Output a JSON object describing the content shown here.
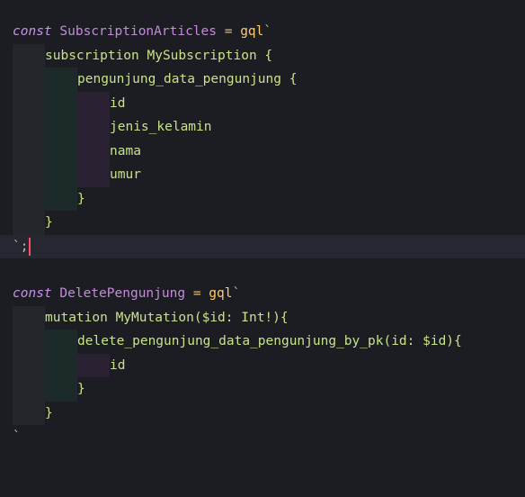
{
  "editor": {
    "block1": {
      "keyword": "const",
      "name": "SubscriptionArticles",
      "equals": "=",
      "tag": "gql",
      "open_tick": "`",
      "lines": [
        "subscription MySubscription {",
        "pengunjung_data_pengunjung {",
        "id",
        "jenis_kelamin",
        "nama",
        "umur",
        "}",
        "}"
      ],
      "close": "`;"
    },
    "block2": {
      "keyword": "const",
      "name": "DeletePengunjung",
      "equals": "=",
      "tag": "gql",
      "open_tick": "`",
      "lines": [
        "mutation MyMutation($id: Int!){",
        "delete_pengunjung_data_pengunjung_by_pk(id: $id){",
        "id",
        "}",
        "}"
      ],
      "close": "`"
    }
  },
  "colors": {
    "background": "#1b1d23",
    "keyword": "#c792ea",
    "tag": "#ffcb6b",
    "gql_text": "#c8e38a",
    "cursor": "#ff4d6d"
  }
}
